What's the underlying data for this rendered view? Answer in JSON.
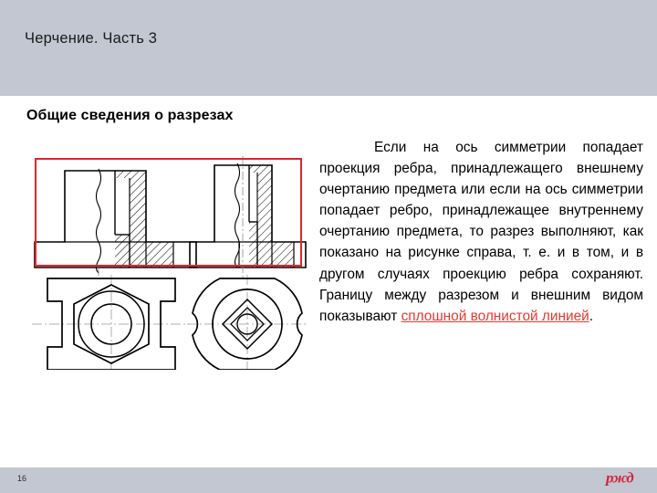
{
  "header": {
    "title": "Черчение. Часть 3",
    "band_color": "#c3c7d2"
  },
  "section": {
    "heading": "Общие сведения о разрезах"
  },
  "body": {
    "paragraph_part1": "Если на ось симметрии попадает проекция ребра, принадлежащего внешнему очертанию предмета или если на ось симметрии попадает ребро, принадлежащее внутреннему очертанию предмета, то разрез выполняют, как показано на рисунке справа, т. е. и в том, и в другом случаях проекцию ребра сохраняют. Границу между разрезом и внешним видом показывают ",
    "highlight": "сплошной волнистой линией",
    "paragraph_part2": ".",
    "highlight_color": "#e03a32"
  },
  "figure": {
    "caption": "",
    "highlight_box_color": "#e0252b",
    "views": [
      {
        "name": "front-view-left",
        "description": "Половинный разрез детали с шестигранником, вид спереди"
      },
      {
        "name": "front-view-right",
        "description": "Половинный разрез детали с квадратным отверстием, вид спереди"
      },
      {
        "name": "top-view-left",
        "description": "Вид сверху: прямоугольник с пазами, шестигранник и окружности"
      },
      {
        "name": "top-view-right",
        "description": "Вид сверху: скруглённая деталь с пазами, окружность и ромб"
      }
    ]
  },
  "footer": {
    "page_number": "16",
    "logo_text": "ржд",
    "logo_color": "#d4243a",
    "band_color": "#c3c7d2"
  }
}
